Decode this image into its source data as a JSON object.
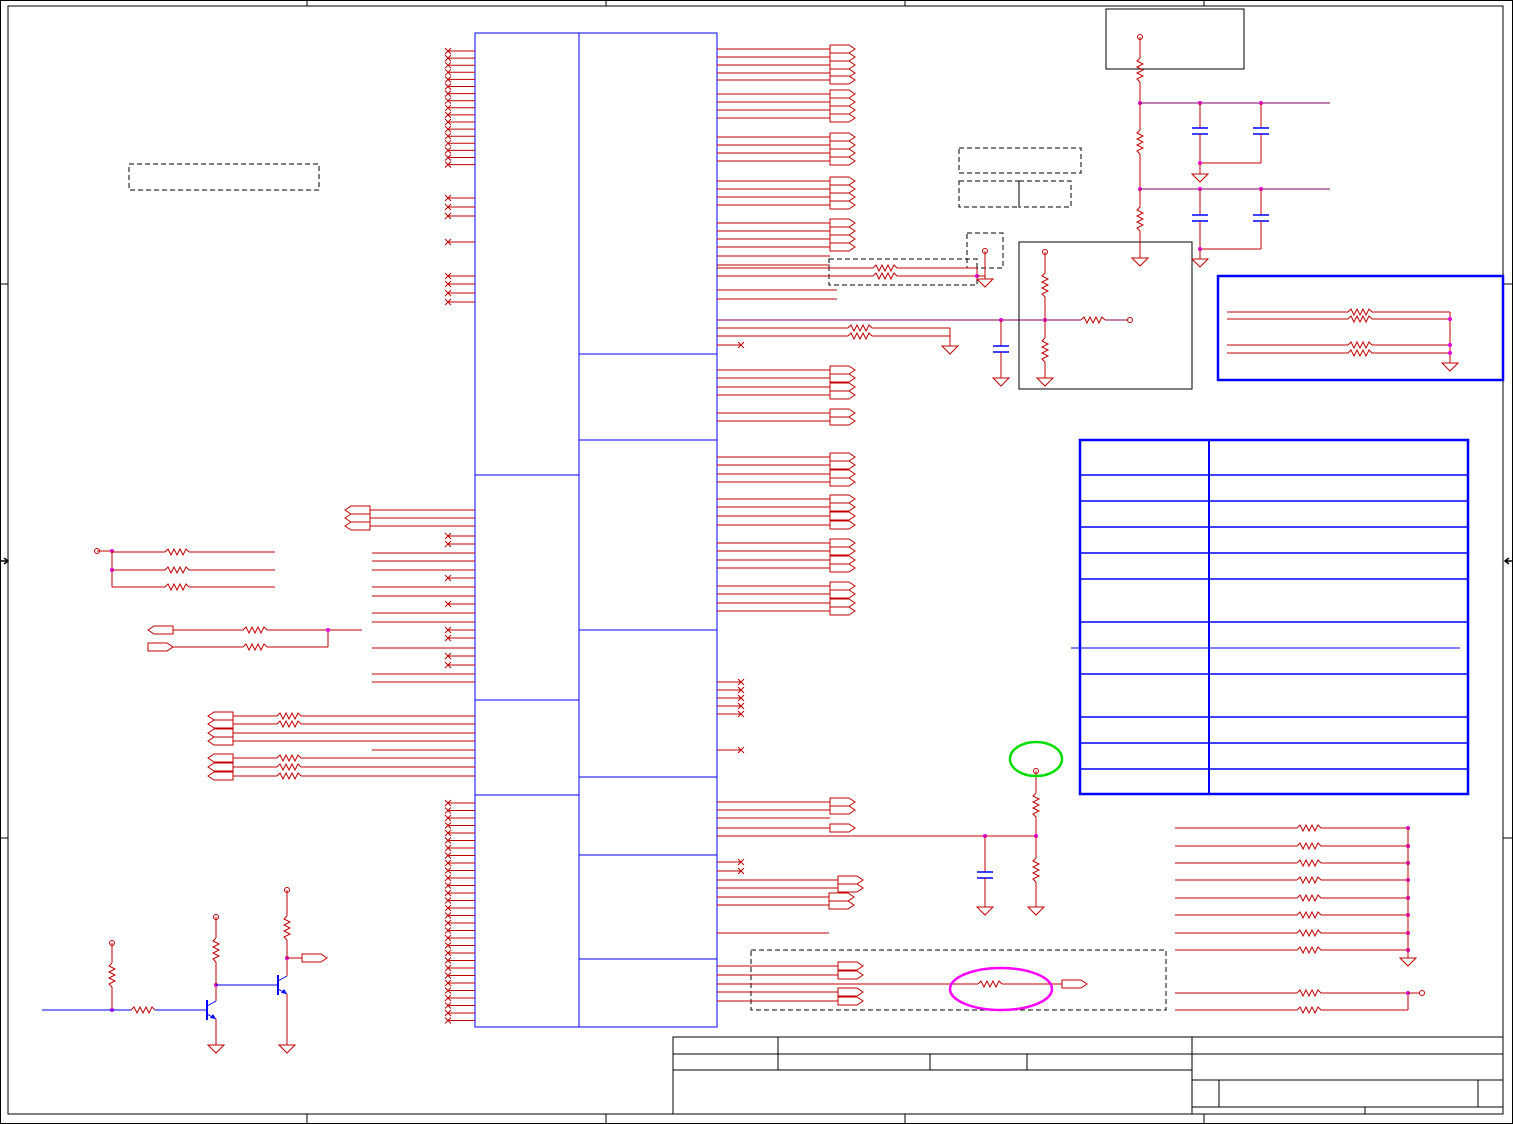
{
  "colors": {
    "wire": "#c00000",
    "bus": "#0000ff",
    "net": "#800060",
    "junction": "#e000e0",
    "frame": "#000000",
    "highlight_green": "#00dd00",
    "highlight_magenta": "#ff00ff",
    "sheet": "#ffffff"
  },
  "symbols": {
    "resistor": "resistor-icon",
    "capacitor": "capacitor-icon",
    "ground": "ground-icon",
    "transistor": "npn-transistor-icon",
    "port_out": "off-page-connector-out-icon",
    "port_in": "off-page-connector-in-icon",
    "no_connect": "no-connect-icon",
    "test_point": "test-point-icon"
  }
}
